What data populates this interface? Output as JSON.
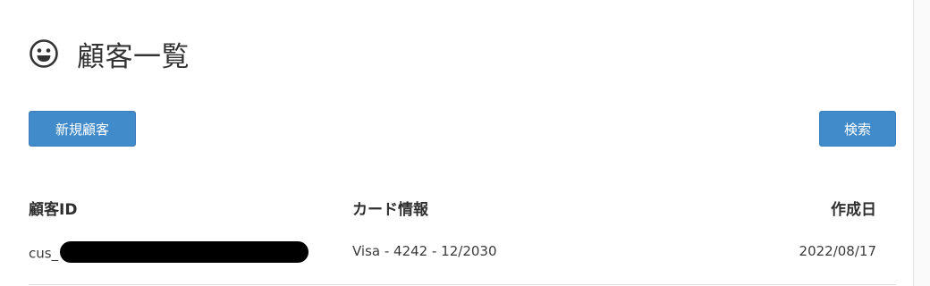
{
  "header": {
    "icon": "smiley-face-icon",
    "title": "顧客一覧"
  },
  "toolbar": {
    "new_customer_label": "新規顧客",
    "search_label": "検索"
  },
  "colors": {
    "button_bg": "#428bca",
    "button_text": "#ffffff",
    "text": "#333333",
    "divider": "#dcdcdc"
  },
  "table": {
    "columns": [
      "顧客ID",
      "カード情報",
      "作成日"
    ],
    "rows": [
      {
        "customer_id_prefix": "cus_",
        "customer_id_redacted": true,
        "card_info": "Visa - 4242 - 12/2030",
        "created_at": "2022/08/17"
      }
    ]
  }
}
